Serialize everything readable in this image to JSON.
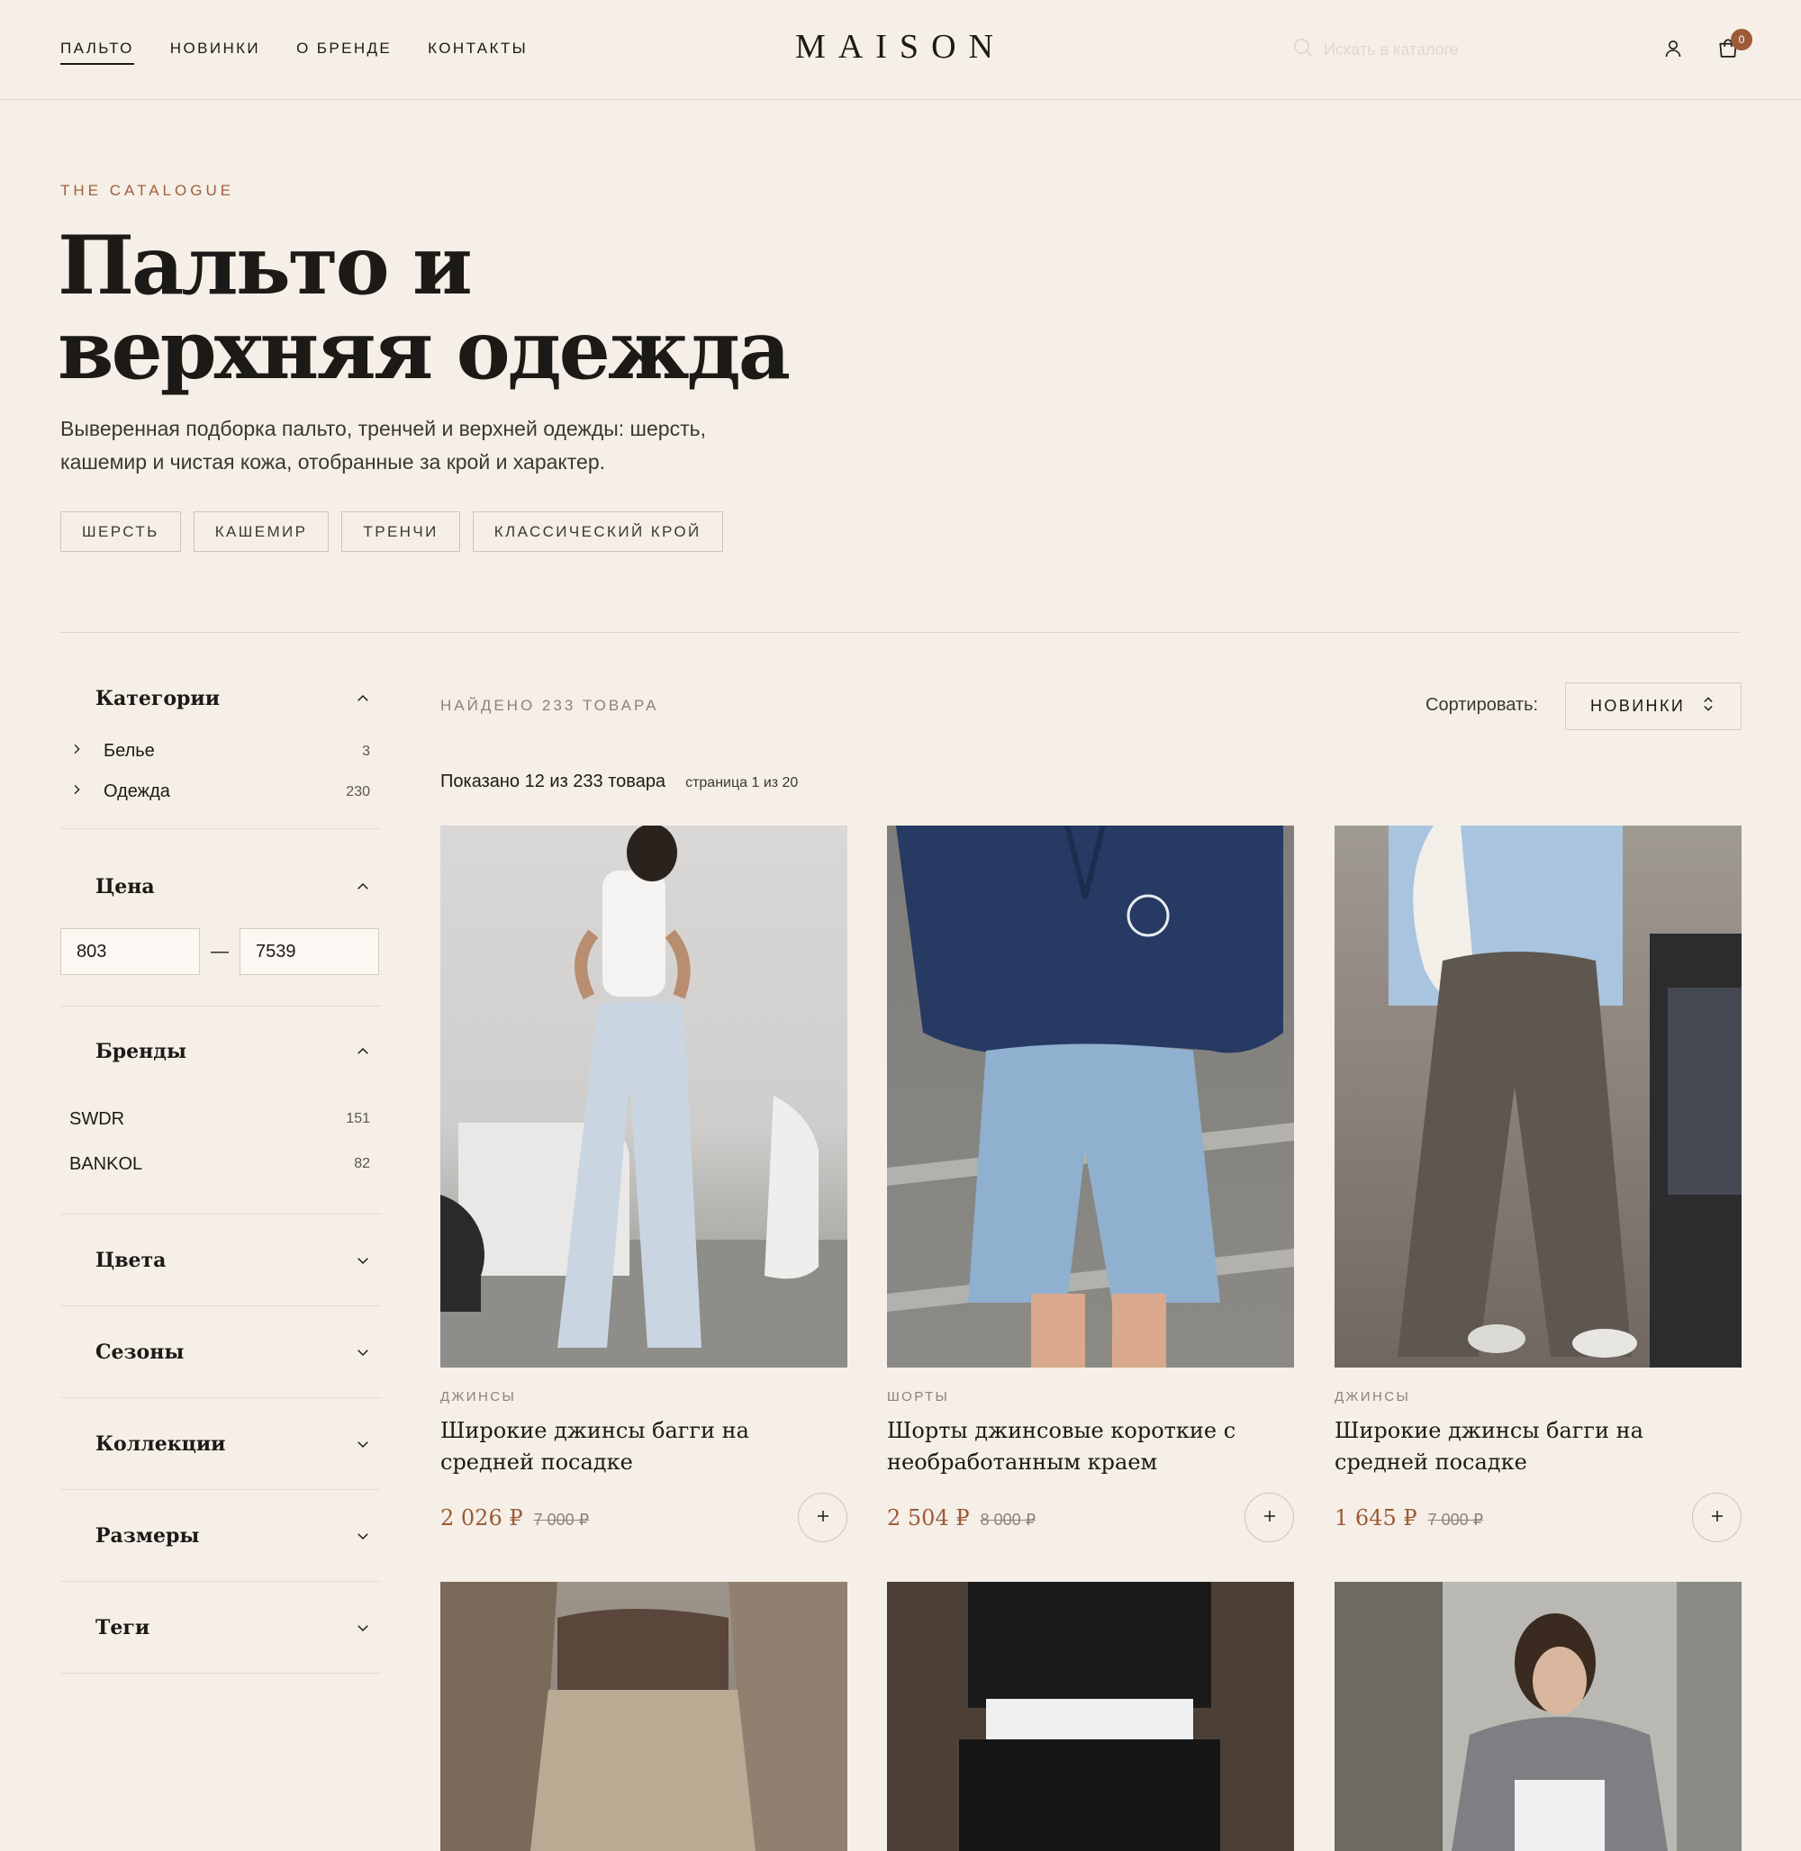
{
  "nav": {
    "items": [
      "ПАЛЬТО",
      "НОВИНКИ",
      "О БРЕНДЕ",
      "КОНТАКТЫ"
    ],
    "active_index": 0
  },
  "brand": {
    "logo": "MAISON"
  },
  "search": {
    "placeholder": "Искать в каталоге"
  },
  "cart": {
    "count": "0"
  },
  "hero": {
    "eyebrow": "THE CATALOGUE",
    "title": "Пальто и верхняя одежда",
    "description": "Выверенная подборка пальто, тренчей и верхней одежды: шерсть, кашемир и чистая кожа, отобранные за крой и характер.",
    "chips": [
      "ШЕРСТЬ",
      "КАШЕМИР",
      "ТРЕНЧИ",
      "КЛАССИЧЕСКИЙ КРОЙ"
    ]
  },
  "filters": {
    "categories": {
      "title": "Категории",
      "items": [
        {
          "label": "Белье",
          "count": "3"
        },
        {
          "label": "Одежда",
          "count": "230"
        }
      ]
    },
    "price": {
      "title": "Цена",
      "min": "803",
      "max": "7539",
      "separator": "—"
    },
    "brands": {
      "title": "Бренды",
      "items": [
        {
          "label": "SWDR",
          "count": "151"
        },
        {
          "label": "BANKOL",
          "count": "82"
        }
      ]
    },
    "collapsed": [
      "Цвета",
      "Сезоны",
      "Коллекции",
      "Размеры",
      "Теги"
    ]
  },
  "results": {
    "found": "НАЙДЕНО 233 ТОВАРА",
    "sort_label": "Сортировать:",
    "sort_value": "НОВИНКИ",
    "shown": "Показано 12 из 233 товара",
    "page": "страница 1 из 20"
  },
  "products": [
    {
      "category": "ДЖИНСЫ",
      "name": "Широкие джинсы багги на средней посадке",
      "price": "2 026 ₽",
      "old_price": "7 000 ₽"
    },
    {
      "category": "ШОРТЫ",
      "name": "Шорты джинсовые короткие с необработанным краем",
      "price": "2 504 ₽",
      "old_price": "8 000 ₽"
    },
    {
      "category": "ДЖИНСЫ",
      "name": "Широкие джинсы багги на средней посадке",
      "price": "1 645 ₽",
      "old_price": "7 000 ₽"
    }
  ],
  "colors": {
    "accent": "#9c5a36",
    "background": "#f5efe7",
    "text": "#1c1a17",
    "muted": "#8a837a"
  }
}
